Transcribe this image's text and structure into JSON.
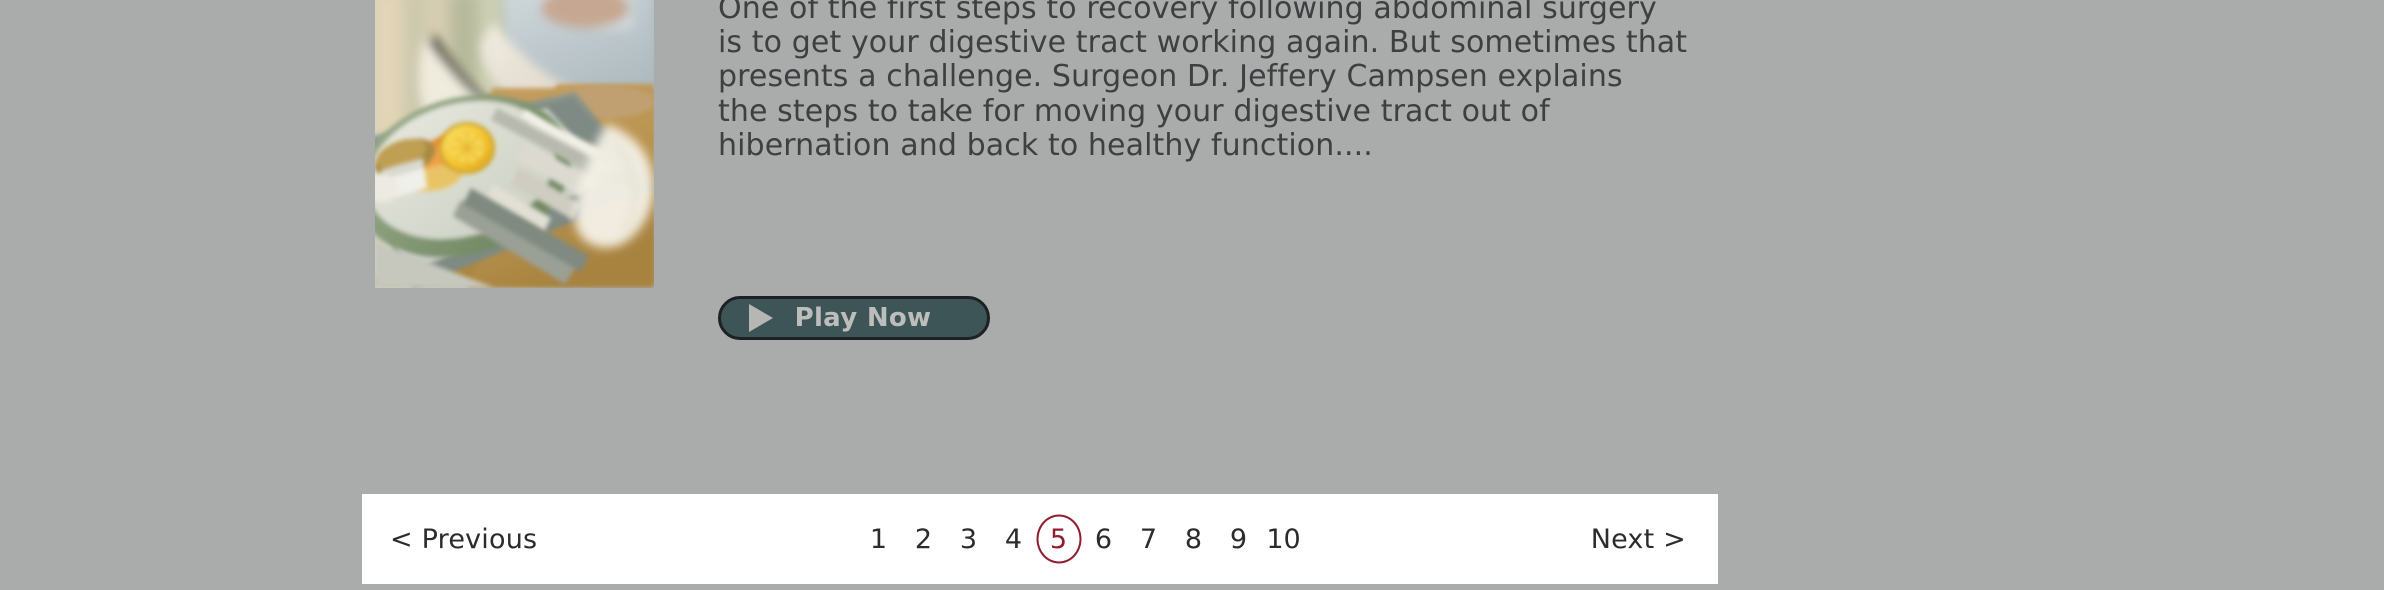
{
  "page": {
    "background_color": "#aaabab"
  },
  "article": {
    "thumbnail": {
      "icon": "hospital-meal-tray-photo",
      "alt": "Hospital meal tray with plate of food, lemon slice and cutlery"
    },
    "excerpt": "One of the first steps to recovery following abdominal surgery\nis to get your digestive tract working again. But sometimes that\npresents a challenge. Surgeon Dr. Jeffery Campsen explains\nthe steps to take for moving your digestive tract out of\nhibernation and back to healthy function....",
    "play_button": {
      "label": "Play Now",
      "icon": "play-triangle-icon",
      "background_color": "#3d5556",
      "border_color": "#1d2123",
      "text_color": "#bdbdbb"
    }
  },
  "pagination": {
    "previous_label": "< Previous",
    "next_label": "Next >",
    "active_page": "5",
    "active_color": "#8f1f30",
    "bar_background": "#ffffff",
    "pages": [
      {
        "label": "1",
        "active": false
      },
      {
        "label": "2",
        "active": false
      },
      {
        "label": "3",
        "active": false
      },
      {
        "label": "4",
        "active": false
      },
      {
        "label": "5",
        "active": true
      },
      {
        "label": "6",
        "active": false
      },
      {
        "label": "7",
        "active": false
      },
      {
        "label": "8",
        "active": false
      },
      {
        "label": "9",
        "active": false
      },
      {
        "label": "10",
        "active": false
      }
    ]
  }
}
